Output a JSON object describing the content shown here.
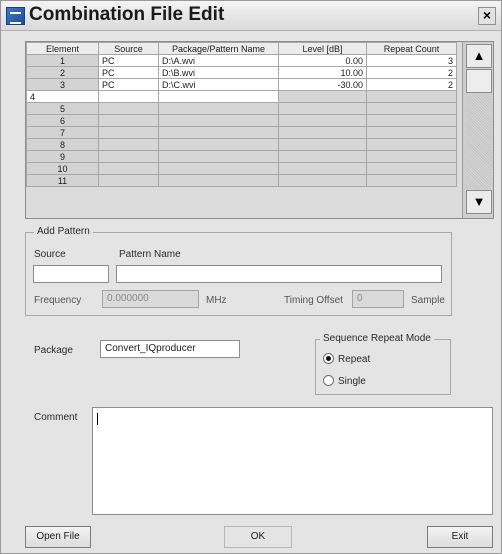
{
  "window": {
    "title": "Combination File Edit",
    "close_glyph": "×"
  },
  "table": {
    "headers": [
      "Element",
      "Source",
      "Package/Pattern Name",
      "Level [dB]",
      "Repeat Count"
    ],
    "rows": [
      [
        "1",
        "PC",
        "D:\\A.wvi",
        "0.00",
        "3"
      ],
      [
        "2",
        "PC",
        "D:\\B.wvi",
        "10.00",
        "2"
      ],
      [
        "3",
        "PC",
        "D:\\C.wvi",
        "-30.00",
        "2"
      ],
      [
        "4",
        "",
        "",
        "",
        ""
      ],
      [
        "5",
        "",
        "",
        "",
        ""
      ],
      [
        "6",
        "",
        "",
        "",
        ""
      ],
      [
        "7",
        "",
        "",
        "",
        ""
      ],
      [
        "8",
        "",
        "",
        "",
        ""
      ],
      [
        "9",
        "",
        "",
        "",
        ""
      ],
      [
        "10",
        "",
        "",
        "",
        ""
      ],
      [
        "11",
        "",
        "",
        "",
        ""
      ]
    ],
    "scroll_up_glyph": "▲",
    "scroll_down_glyph": "▼"
  },
  "add_pattern": {
    "legend": "Add Pattern",
    "source_label": "Source",
    "source_value": "",
    "pattern_name_label": "Pattern Name",
    "pattern_name_value": "",
    "frequency_label": "Frequency",
    "frequency_value": "0.000000",
    "frequency_unit": "MHz",
    "timing_offset_label": "Timing Offset",
    "timing_offset_value": "0",
    "timing_offset_unit": "Sample"
  },
  "package": {
    "label": "Package",
    "value": "Convert_IQproducer"
  },
  "sequence_repeat_mode": {
    "legend": "Sequence Repeat Mode",
    "options": [
      "Repeat",
      "Single"
    ],
    "selected": "Repeat"
  },
  "comment": {
    "label": "Comment",
    "value": ""
  },
  "buttons": {
    "open_file": "Open File",
    "ok": "OK",
    "exit": "Exit"
  },
  "icons": {
    "app": "app-icon",
    "close": "close-icon",
    "scroll_up": "scroll-up-arrow-icon",
    "scroll_down": "scroll-down-arrow-icon"
  }
}
